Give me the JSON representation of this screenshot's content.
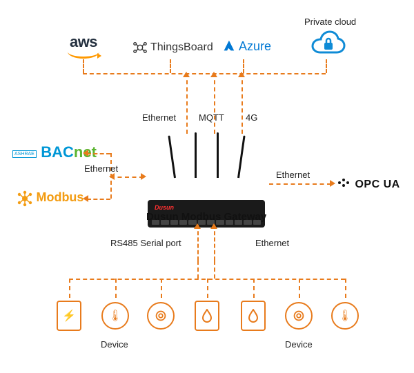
{
  "clouds": {
    "aws": {
      "name": "aws"
    },
    "thingsboard": {
      "name": "ThingsBoard"
    },
    "azure": {
      "name": "Azure"
    },
    "private": {
      "label": "Private cloud"
    }
  },
  "uplinks": {
    "ethernet": "Ethernet",
    "mqtt": "MQTT",
    "fourg": "4G"
  },
  "left_protocols": {
    "bacnet": {
      "ashrae": "ASHRAE",
      "name": "BACnet"
    },
    "modbus": {
      "name": "Modbus"
    },
    "link_label": "Ethernet"
  },
  "right_protocol": {
    "opcua": {
      "name": "OPC UA"
    },
    "link_label": "Ethernet"
  },
  "gateway": {
    "title": "Dusun Modbus Gateway",
    "brand": "Dusun"
  },
  "downlinks": {
    "rs485": "RS485 Serial port",
    "ethernet": "Ethernet"
  },
  "devices": {
    "label_left": "Device",
    "label_right": "Device"
  }
}
